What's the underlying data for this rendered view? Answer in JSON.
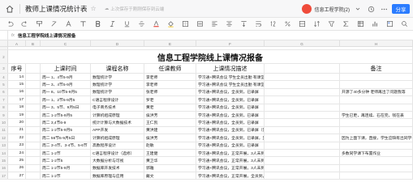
{
  "titlebar": {
    "doc_title": "教师上课情况统计表",
    "save_status": "上次保存于刚刚保存到云端",
    "user_name": "信息工程学院(2)",
    "share_label": "分享"
  },
  "formula_bar": {
    "content": "信息工程学院线上课情况报备"
  },
  "columns": [
    "A",
    "B",
    "C",
    "D",
    "E",
    "F",
    "G",
    "H"
  ],
  "sheet": {
    "title": "信息工程学院线上课情况报备",
    "headers": {
      "seq": "序号",
      "time": "上课时间",
      "course": "课程名称",
      "teacher": "任课教师",
      "desc": "上课情况描述",
      "note": "备注"
    },
    "rows": [
      {
        "rn": "4",
        "seq": "14",
        "time": "周一 1、4节5-9月",
        "course": "数理统计学",
        "teacher": "李老师",
        "desc": "学习通+腾讯会议  学生全员出勤  有课堂练习",
        "note": ""
      },
      {
        "rn": "5",
        "seq": "15",
        "time": "周一 3、4节5-9月",
        "course": "数理统计学",
        "teacher": "李老师",
        "desc": "学习通+腾讯会议  学生全员出勤  有课堂练习",
        "note": ""
      },
      {
        "rn": "6",
        "seq": "16",
        "time": "周一 8、10节5-9月5",
        "course": "数理统计学",
        "teacher": "张老师",
        "desc": "学习通+腾讯会议，全员到，已录屏",
        "note": "开源了40多分钟 老师再出了问题我等"
      },
      {
        "rn": "7",
        "seq": "17",
        "time": "周一 1、2节5-9月5",
        "course": "C语言程序设计",
        "teacher": "罗老",
        "desc": "学习通+腾讯会议，全员到，已录屏",
        "note": ""
      },
      {
        "rn": "8",
        "seq": "18",
        "time": "周一 3、5节、9月5日",
        "course": "电子商务技术",
        "teacher": "黄老",
        "desc": "学习通+腾讯会议，全员到，已录屏",
        "note": ""
      },
      {
        "rn": "9",
        "seq": "19",
        "time": "周二 1-2节5-9月5",
        "course": "计算机组成原理",
        "teacher": "侯洪芳",
        "desc": "学习通+腾讯会议，全员到，已录屏",
        "note": "学生已更，再连续、石在完，钱在表"
      },
      {
        "rn": "10",
        "seq": "20",
        "time": "周二 3,4节6-9",
        "course": "统计计算与大数据技术",
        "teacher": "王仁凯",
        "desc": "学习通+腾讯会议，全员到，已录屏",
        "note": ""
      },
      {
        "rn": "11",
        "seq": "21",
        "time": "周二 1-2节5-9月5",
        "course": "APP开发",
        "teacher": "黄洪建",
        "desc": "学习通+腾讯会议，全员到，已录屏（第一个节录制后面已打开）",
        "note": ""
      },
      {
        "rn": "12",
        "seq": "22",
        "time": "周二 56节5-9月5日",
        "course": "计算机组成原理",
        "teacher": "侯洪芳",
        "desc": "学习通+腾讯会议，全员到，已录屏，里面有小学生  全员到",
        "note": "因为上面下课，直接，学生应缺有出同学名单下"
      },
      {
        "rn": "13",
        "seq": "23",
        "time": "周二 3-4节、3-4节、5-6节",
        "course": "高数程序设计",
        "teacher": "赵敏",
        "desc": "学习通+腾讯会议，全员到，已录屏",
        "note": ""
      },
      {
        "rn": "14",
        "seq": "24",
        "time": "周二 1-2节",
        "course": "C语言程序设计（选修）",
        "teacher": "王建健",
        "desc": "学习通+腾讯会议，正常开展，3人未到，已录屏，第一次使用课不断是",
        "note": "多数同学课下布置作业"
      },
      {
        "rn": "15",
        "seq": "25",
        "time": "周二 1-2节5",
        "course": "大数据分析与可视",
        "teacher": "黄卫华",
        "desc": "学习通+腾讯会议，正常开展，3人未到，已录屏",
        "note": ""
      },
      {
        "rn": "16",
        "seq": "26",
        "time": "周二 1-2节5-9月",
        "course": "数据库开发技术",
        "teacher": "郭雅",
        "desc": "学习通+腾讯会议，正常开展，3人未到，已录屏",
        "note": ""
      },
      {
        "rn": "17",
        "seq": "27",
        "time": "周二 1-2节",
        "course": "数据库原理与应用",
        "teacher": "戴文",
        "desc": "学习通+腾讯会议，正常开展，全员到，已录屏",
        "note": ""
      }
    ]
  }
}
